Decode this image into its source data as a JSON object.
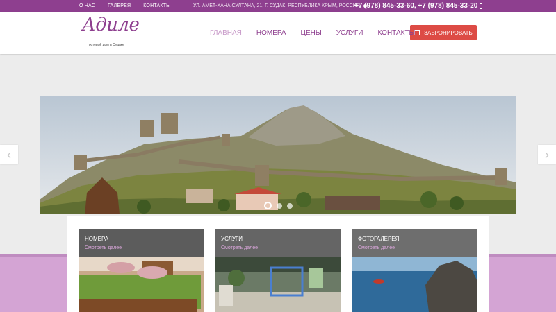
{
  "topbar": {
    "links": [
      "О нас",
      "Галерея",
      "Контакты"
    ],
    "address": "ул. Амет-Хана Султана, 21, г. Судак, Республика Крым, Россия",
    "phones": "+7 (978) 845-33-60, +7 (978) 845-33-20",
    "accent": "#8e3f8f"
  },
  "logo": {
    "name": "Адиле",
    "tagline": "гостевой дом в Судаке"
  },
  "nav": {
    "items": [
      "Главная",
      "Номера",
      "Цены",
      "Услуги",
      "Контакты"
    ],
    "active": "Главная"
  },
  "book_button": {
    "label": "Забронировать",
    "icon": "calendar-icon",
    "color": "#dd4b45"
  },
  "slider": {
    "prev_icon": "chevron-left-icon",
    "next_icon": "chevron-right-icon",
    "dots": 3,
    "active_dot": 1
  },
  "cards": [
    {
      "title": "Номера",
      "link": "Смотреть далее"
    },
    {
      "title": "Услуги",
      "link": "Смотреть далее"
    },
    {
      "title": "Фотогалерея",
      "link": "Смотреть далее"
    }
  ]
}
